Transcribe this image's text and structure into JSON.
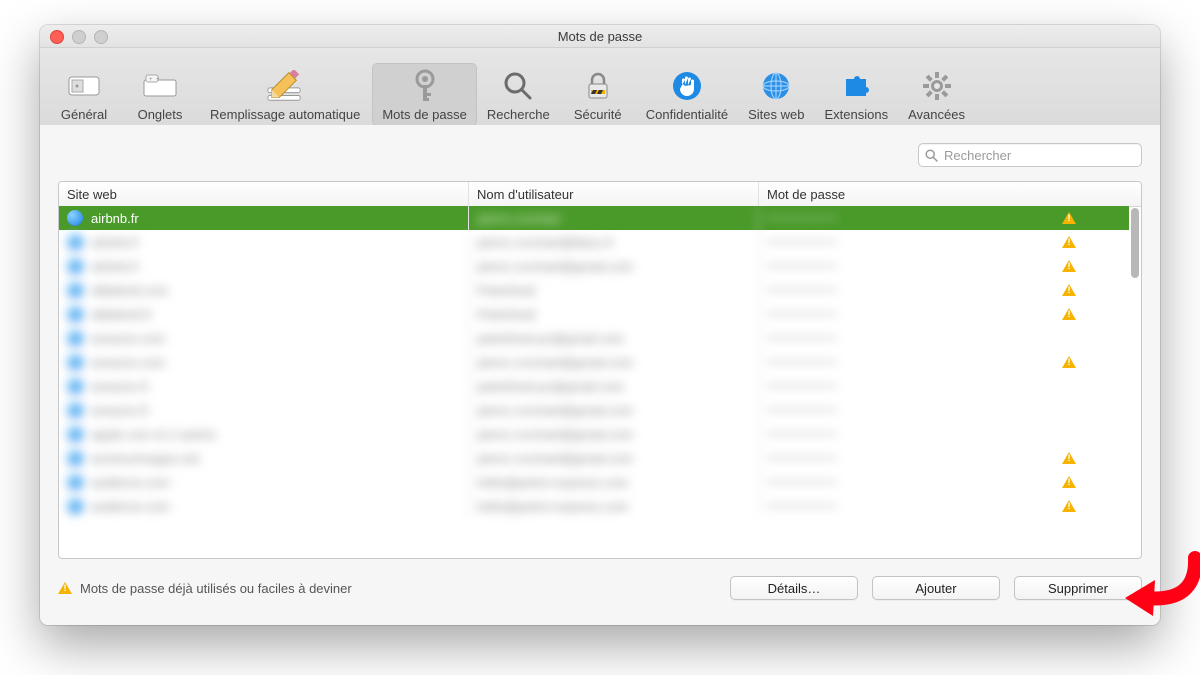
{
  "window": {
    "title": "Mots de passe"
  },
  "toolbar": {
    "tabs": [
      {
        "id": "general",
        "label": "Général"
      },
      {
        "id": "tabs",
        "label": "Onglets"
      },
      {
        "id": "autofill",
        "label": "Remplissage automatique"
      },
      {
        "id": "passwords",
        "label": "Mots de passe"
      },
      {
        "id": "search",
        "label": "Recherche"
      },
      {
        "id": "security",
        "label": "Sécurité"
      },
      {
        "id": "privacy",
        "label": "Confidentialité"
      },
      {
        "id": "websites",
        "label": "Sites web"
      },
      {
        "id": "extensions",
        "label": "Extensions"
      },
      {
        "id": "advanced",
        "label": "Avancées"
      }
    ],
    "selected": "passwords"
  },
  "search": {
    "placeholder": "Rechercher"
  },
  "columns": {
    "site": "Site web",
    "user": "Nom d'utilisateur",
    "pass": "Mot de passe"
  },
  "rows": [
    {
      "site": "airbnb.fr",
      "user": "pierre.crochart",
      "pass": "••••••••",
      "warn": true,
      "selected": true,
      "obscured": false
    },
    {
      "site": "airbnb.fr",
      "user": "pierre.crochart@bbox.fr",
      "pass": "••••••••",
      "warn": true,
      "selected": false,
      "obscured": true
    },
    {
      "site": "airbnb.fr",
      "user": "pierre.crochart@gmail.com",
      "pass": "••••••••",
      "warn": true,
      "selected": false,
      "obscured": true
    },
    {
      "site": "alldebrid.com",
      "user": "Peterlined",
      "pass": "••••••••",
      "warn": true,
      "selected": false,
      "obscured": true
    },
    {
      "site": "alldebrid.fr",
      "user": "Peterlined",
      "pass": "••••••••",
      "warn": true,
      "selected": false,
      "obscured": true
    },
    {
      "site": "amazon.com",
      "user": "peterlined.pc@gmail.com",
      "pass": "••••••••",
      "warn": false,
      "selected": false,
      "obscured": true
    },
    {
      "site": "amazon.com",
      "user": "pierre.crochart@gmail.com",
      "pass": "••••••••",
      "warn": true,
      "selected": false,
      "obscured": true
    },
    {
      "site": "amazon.fr",
      "user": "peterlined.pc@gmail.com",
      "pass": "••••••••",
      "warn": false,
      "selected": false,
      "obscured": true
    },
    {
      "site": "amazon.fr",
      "user": "pierre.crochart@gmail.com",
      "pass": "••••••••",
      "warn": false,
      "selected": false,
      "obscured": true
    },
    {
      "site": "apple.com et 2 autres",
      "user": "pierre.crochart@gmail.com",
      "pass": "••••••••",
      "warn": false,
      "selected": false,
      "obscured": true
    },
    {
      "site": "arretsurimages.net",
      "user": "pierre.crochart@gmail.com",
      "pass": "••••••••",
      "warn": true,
      "selected": false,
      "obscured": true
    },
    {
      "site": "audierne.com",
      "user": "hello@petrin-express.com",
      "pass": "••••••••",
      "warn": true,
      "selected": false,
      "obscured": true
    },
    {
      "site": "audierne.com",
      "user": "hello@petrin-express.com",
      "pass": "••••••••",
      "warn": true,
      "selected": false,
      "obscured": true
    }
  ],
  "footer": {
    "warning_text": "Mots de passe déjà utilisés ou faciles à deviner",
    "details": "Détails…",
    "add": "Ajouter",
    "remove": "Supprimer"
  }
}
